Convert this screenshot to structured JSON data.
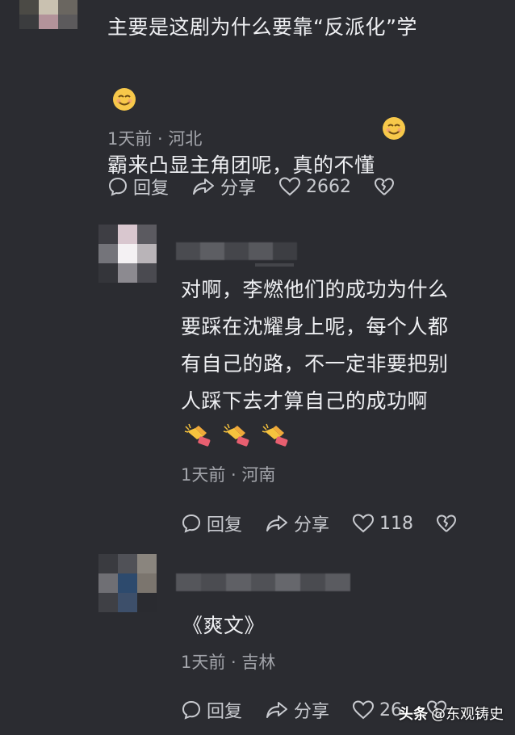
{
  "comments": [
    {
      "text_line1": "主要是这剧为什么要靠“反派化”学",
      "text_line2": "霸来凸显主角团呢，真的不懂",
      "emoji": "smile-emoji",
      "meta": "1天前 · 河北",
      "reply_label": "回复",
      "share_label": "分享",
      "likes": "2662"
    },
    {
      "text_line1": "对啊，李燃他们的成功为什么",
      "text_line2": "要踩在沈耀身上呢，每个人都",
      "text_line3": "有自己的路，不一定非要把别",
      "text_line4": "人踩下去才算自己的成功啊",
      "emoji": "clapping-hands-emoji",
      "meta": "1天前 · 河南",
      "reply_label": "回复",
      "share_label": "分享",
      "likes": "118"
    },
    {
      "text_line1": "《爽文》",
      "meta": "1天前 · 吉林",
      "reply_label": "回复",
      "share_label": "分享",
      "likes": "26"
    }
  ],
  "watermark": {
    "logo": "头条",
    "handle": "@东观铸史"
  },
  "colors": {
    "background": "#2b2c31",
    "text": "#eeeff2",
    "meta": "#a3a5ab",
    "icon": "#c9cbd0"
  }
}
